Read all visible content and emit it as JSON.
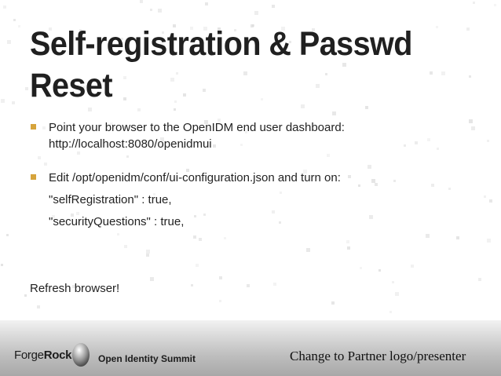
{
  "slide": {
    "title": "Self-registration & Passwd Reset",
    "bullets": [
      {
        "text": "Point your browser to the OpenIDM end user dashboard: http://localhost:8080/openidmui",
        "lines": []
      },
      {
        "text": "Edit /opt/openidm/conf/ui-configuration.json and turn on:",
        "lines": [
          "\"selfRegistration\" : true,",
          "\"securityQuestions\" : true,"
        ]
      }
    ],
    "closing_text": "Refresh browser!"
  },
  "footer": {
    "logo_part1": "Forge",
    "logo_part2": "Rock",
    "event_name": "Open Identity Summit",
    "partner_text": "Change to Partner logo/presenter"
  },
  "colors": {
    "title": "#202020",
    "bullet_marker": "#d6a43c",
    "footer_gradient_top": "#f2f2f2",
    "footer_gradient_bottom": "#a8a8a8"
  },
  "icons": {
    "bullet": "square-bullet-icon",
    "logo": "forgerock-pebble-icon"
  }
}
